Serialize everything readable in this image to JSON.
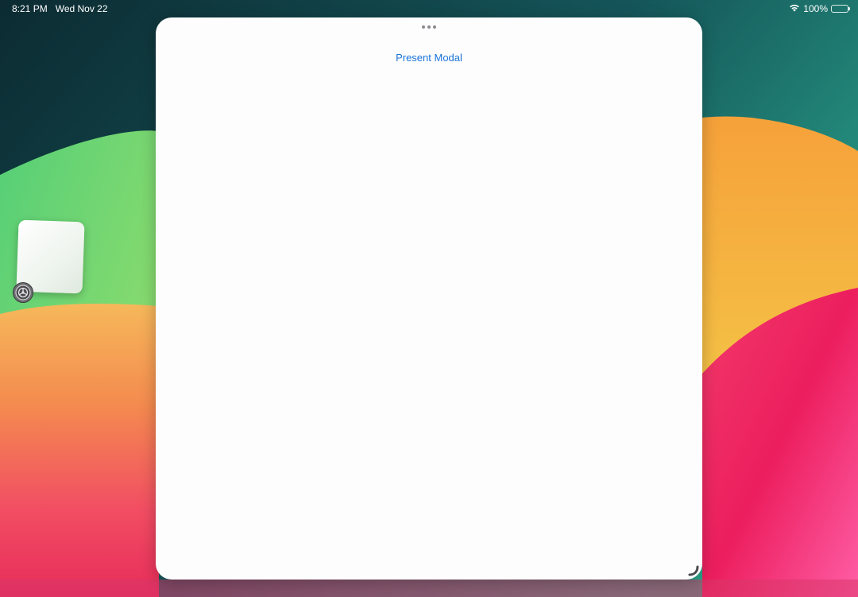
{
  "status_bar": {
    "time": "8:21 PM",
    "date": "Wed Nov 22",
    "battery_percent": "100%",
    "wifi_icon": "wifi-icon",
    "battery_icon": "battery-full-icon"
  },
  "app_window": {
    "multitasking_icon": "ellipsis-icon",
    "present_modal_label": "Present Modal",
    "resize_icon": "resize-corner-icon",
    "link_color": "#1a73d9"
  },
  "stage_manager": {
    "app_icon": "settings-gear-icon"
  }
}
